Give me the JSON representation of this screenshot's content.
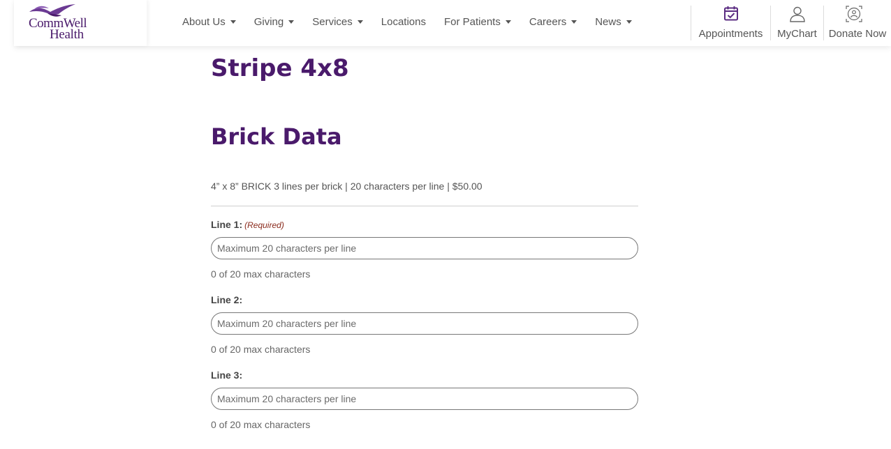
{
  "header": {
    "logo": {
      "line1": "CommWell",
      "line2": "Health"
    },
    "nav": [
      {
        "label": "About Us",
        "dropdown": true
      },
      {
        "label": "Giving",
        "dropdown": true
      },
      {
        "label": "Services",
        "dropdown": true
      },
      {
        "label": "Locations",
        "dropdown": false
      },
      {
        "label": "For Patients",
        "dropdown": true
      },
      {
        "label": "Careers",
        "dropdown": true
      },
      {
        "label": "News",
        "dropdown": true
      }
    ],
    "utility": {
      "appointments": {
        "label": "Appointments",
        "icon": "calendar-check-icon"
      },
      "mychart": {
        "label": "MyChart",
        "icon": "user-icon"
      },
      "donate": {
        "label": "Donate Now",
        "icon": "donate-icon"
      }
    }
  },
  "main": {
    "title": "Stripe 4x8",
    "section_title": "Brick Data",
    "description": "4” x 8” BRICK 3 lines per brick | 20 characters per line | $50.00",
    "fields": [
      {
        "label": "Line 1:",
        "required": "(Required)",
        "placeholder": "Maximum 20 characters per line",
        "value": "",
        "counter": "0 of 20 max characters"
      },
      {
        "label": "Line 2:",
        "required": "",
        "placeholder": "Maximum 20 characters per line",
        "value": "",
        "counter": "0 of 20 max characters"
      },
      {
        "label": "Line 3:",
        "required": "",
        "placeholder": "Maximum 20 characters per line",
        "value": "",
        "counter": "0 of 20 max characters"
      }
    ]
  },
  "colors": {
    "brand_purple": "#4a1a6b",
    "icon_purple": "#5b2c82",
    "required_red": "#8a2a1c"
  }
}
